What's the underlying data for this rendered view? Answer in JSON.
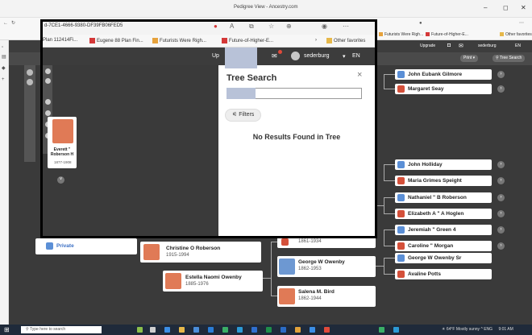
{
  "window": {
    "title": "Pedigree View - Ancestry.com",
    "controls": [
      "–",
      "◻",
      "✕"
    ]
  },
  "background_browser": {
    "bookmarks": [
      "Futurists Were Righ...",
      "Future-of-Higher-E...",
      "Other favorites"
    ],
    "nav": {
      "upgrade": "Upgrade",
      "user": "sederburg",
      "lang": "EN",
      "print": "Print",
      "tree_search": "Tree Search"
    }
  },
  "popup": {
    "url": "d-7CE1-4666-9380-DF39FB06FED5",
    "bookmarks": [
      "Plan 112414Fi...",
      "Eugene 88 Plan Fin...",
      "Futurists Were Righ...",
      "Future-of-Higher-E...",
      "Other favorites"
    ],
    "nav": {
      "upgrade": "Up",
      "user": "sederburg",
      "lang": "EN"
    },
    "person_card": {
      "name": "Everett \" Roberson H",
      "dates": "1877-1908"
    },
    "search_panel": {
      "title": "Tree Search",
      "close": "×",
      "input_value": "",
      "filters_label": "Filters",
      "no_results": "No Results Found in Tree"
    }
  },
  "tree": {
    "right_column": [
      {
        "name": "John Eubank Gilmore",
        "gender": "male"
      },
      {
        "name": "Margaret Seay",
        "gender": "female"
      },
      {
        "name": "John Holliday",
        "gender": "male"
      },
      {
        "name": "Maria Grimes Speight",
        "gender": "female"
      },
      {
        "name": "Nathaniel \" B Roberson",
        "gender": "male"
      },
      {
        "name": "Elizabeth A \" A Hoglen",
        "gender": "female"
      },
      {
        "name": "Jeremiah \" Green 4",
        "gender": "male"
      },
      {
        "name": "Caroline \" Morgan",
        "gender": "female"
      },
      {
        "name": "George W Owenby Sr",
        "gender": "male"
      },
      {
        "name": "Avaline Potts",
        "gender": "female"
      }
    ],
    "cards": [
      {
        "name": "Private",
        "dates": "",
        "gender": "male"
      },
      {
        "name": "",
        "dates": "1861-1934",
        "gender": "female"
      },
      {
        "name": "Christine O Roberson",
        "dates": "1915-1994",
        "gender": "female"
      },
      {
        "name": "George W Owenby",
        "dates": "1862-1953",
        "gender": "male"
      },
      {
        "name": "Estella Naomi Owenby",
        "dates": "1885-1976",
        "gender": "female"
      },
      {
        "name": "Salena M. Bird",
        "dates": "1862-1944",
        "gender": "female"
      }
    ]
  },
  "taskbar": {
    "search_placeholder": "Type here to search",
    "weather": "64°F Mostly sunny",
    "lang": "ENG",
    "time": "9:01 AM"
  }
}
